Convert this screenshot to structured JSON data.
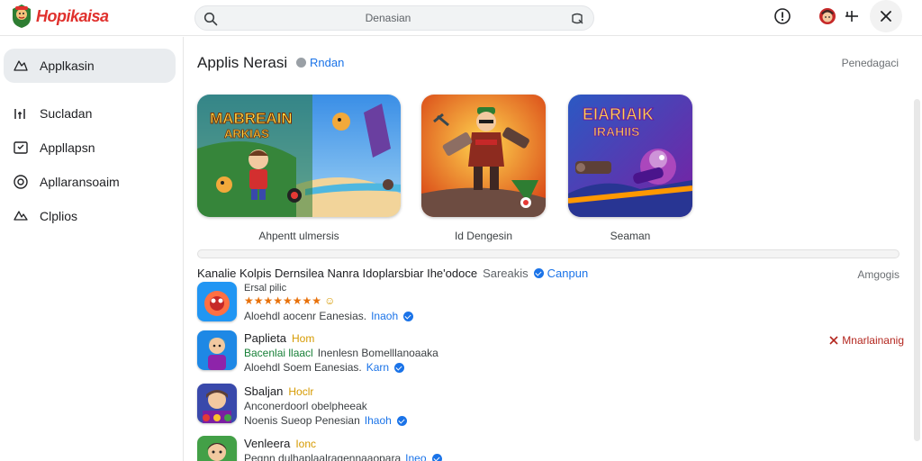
{
  "app": {
    "name": "Hopikaisa"
  },
  "search": {
    "placeholder": "Denasian"
  },
  "sidebar": {
    "items": [
      {
        "label": "Applkasin",
        "icon": "apps-icon",
        "active": true
      },
      {
        "label": "Sucladan",
        "icon": "chart-icon",
        "active": false
      },
      {
        "label": "Appllapsn",
        "icon": "library-icon",
        "active": false
      },
      {
        "label": "Apllaransoaim",
        "icon": "compass-icon",
        "active": false
      },
      {
        "label": "Clplios",
        "icon": "tag-icon",
        "active": false
      }
    ]
  },
  "featured": {
    "title": "Applis Nerasi",
    "badge": "Rndan",
    "link": "Penedagaci",
    "cards": [
      {
        "label": "Ahpentt ulmersis",
        "art_title": "MABREAIN ARKIAS"
      },
      {
        "label": "Id Dengesin"
      },
      {
        "label": "Seaman",
        "art_title": "EIARIAIK IRAHIIS"
      }
    ]
  },
  "list": {
    "header_text": "Kanalie  Kolpis Dernsilea  Nanra Idoplarsbiar Ihe'odoce",
    "header_sep": "Sareakis",
    "header_badge": "Canpun",
    "header_right": "Amgogis",
    "rows": [
      {
        "title": "Ersal pilic",
        "line2": "★★★★★★★★",
        "line2_extra": "☺",
        "line3": "Aloehdl aocenr  Eanesias.",
        "line3_link": "Inaoh"
      },
      {
        "title": "Paplieta",
        "tag": "Hom",
        "line2_green": "Bacenlai llaacl",
        "line2": "Inenlesn Bomelllanoaaka",
        "line3": "Aloehdl Soem  Eanesias.",
        "line3_link": "Karn",
        "action": "Mnarlainanig"
      },
      {
        "title": "Sbaljan",
        "tag": "Hoclr",
        "line2": "Anconerdoorl obelpheeak",
        "line3": "Noenis  Sueop  Penesian",
        "line3_link": "Ihaoh"
      },
      {
        "title": "Venleera",
        "tag": "Ionc",
        "line2": "Pegnn dulhaplaalragennaaopara",
        "line3": "",
        "line3_link": "Ineo"
      }
    ]
  },
  "colors": {
    "brand": "#e0312d",
    "accent": "#1a73e8",
    "active_nav": "#e9ecef",
    "action": "#b3261e"
  }
}
